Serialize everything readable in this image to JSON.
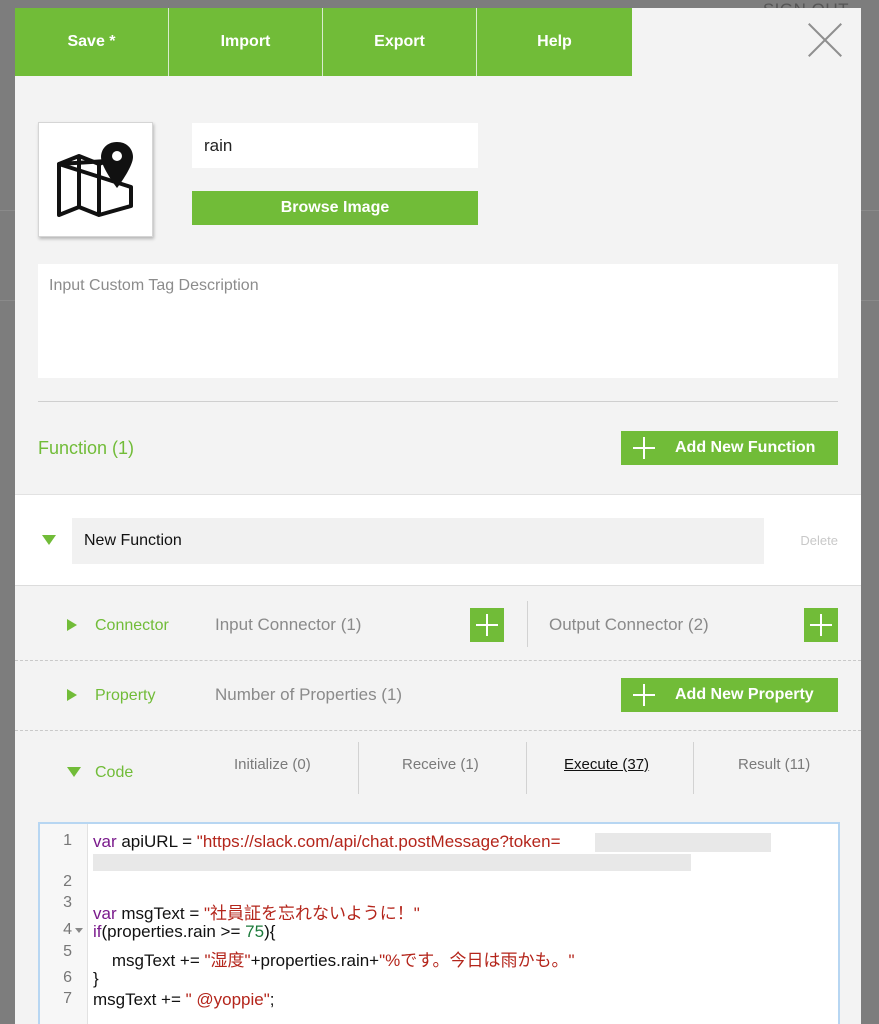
{
  "background": {
    "signout_label": "SIGN OUT"
  },
  "toolbar": {
    "tabs": [
      {
        "label": "Save *"
      },
      {
        "label": "Import"
      },
      {
        "label": "Export"
      },
      {
        "label": "Help"
      }
    ]
  },
  "tag": {
    "name_value": "rain",
    "icon": "map-pin-icon",
    "browse_label": "Browse Image",
    "description_placeholder": "Input Custom Tag Description"
  },
  "functions": {
    "title": "Function (1)",
    "add_label": "Add New Function",
    "item": {
      "name": "New Function",
      "delete_label": "Delete"
    }
  },
  "connector": {
    "label": "Connector",
    "input_label": "Input Connector (1)",
    "output_label": "Output Connector (2)"
  },
  "property": {
    "label": "Property",
    "count_label": "Number of Properties (1)",
    "add_label": "Add New Property"
  },
  "code": {
    "label": "Code",
    "tabs": [
      {
        "label": "Initialize (0)"
      },
      {
        "label": "Receive (1)"
      },
      {
        "label": "Execute (37)",
        "active": true
      },
      {
        "label": "Result (11)"
      }
    ],
    "line_numbers": [
      "1",
      "2",
      "3",
      "4",
      "5",
      "6",
      "7"
    ],
    "lines": {
      "l1_kw": "var",
      "l1_a": " apiURL = ",
      "l1_str": "\"https://slack.com/api/chat.postMessage?token=",
      "l3_kw": "var",
      "l3_a": " msgText = ",
      "l3_str": "\"社員証を忘れないように！\"",
      "l4_kw": "if",
      "l4_a": "(properties.rain >= ",
      "l4_num": "75",
      "l4_b": "){",
      "l5_a": "    msgText += ",
      "l5_str1": "\"湿度\"",
      "l5_b": "+properties.rain+",
      "l5_str2": "\"%です。今日は雨かも。\"",
      "l6": "}",
      "l7_a": "msgText += ",
      "l7_str": "\" @yoppie\"",
      "l7_b": ";"
    }
  },
  "colors": {
    "accent": "#71bc38",
    "panel": "#f3f3f3",
    "overlay": "#7d7d7d"
  }
}
